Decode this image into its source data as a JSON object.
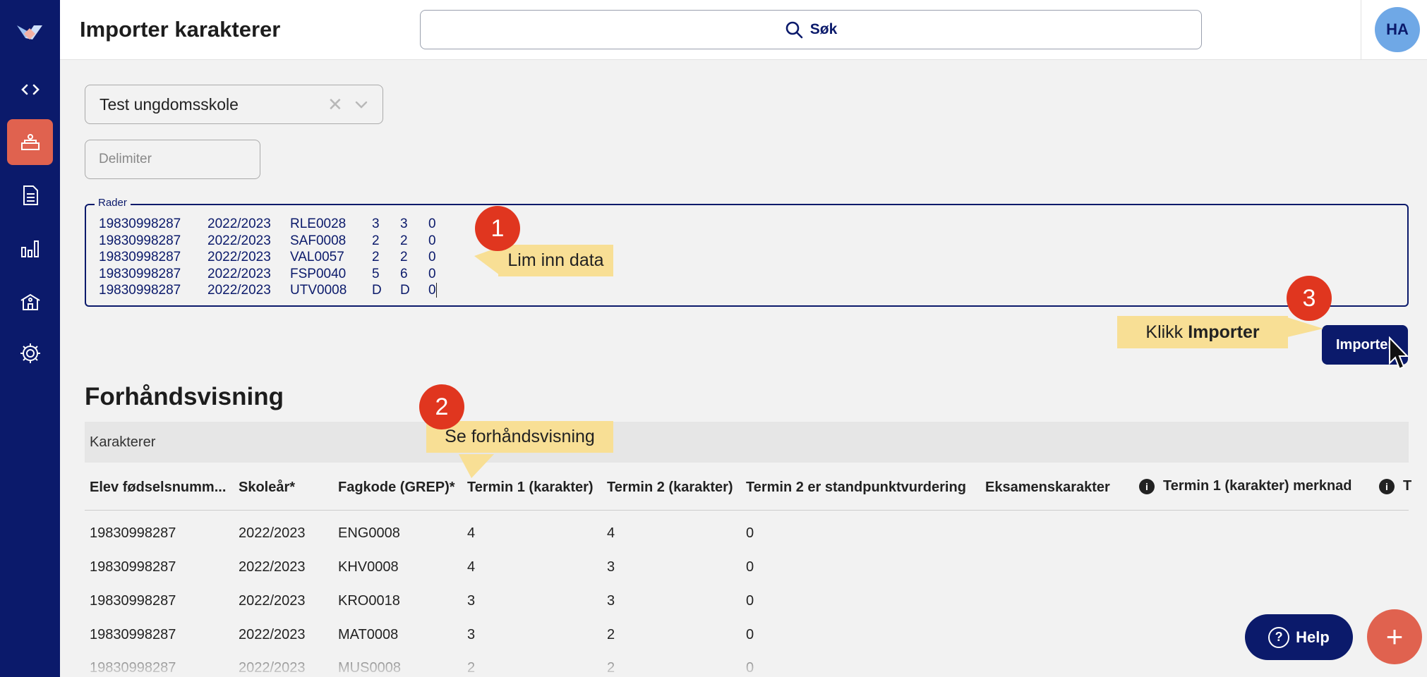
{
  "header": {
    "title": "Importer karakterer",
    "search_label": "Søk",
    "avatar_initials": "HA"
  },
  "sidebar": {
    "items": [
      {
        "icon": "code-icon"
      },
      {
        "icon": "school-desk-icon",
        "active": true
      },
      {
        "icon": "document-icon"
      },
      {
        "icon": "bar-chart-icon"
      },
      {
        "icon": "school-building-icon"
      },
      {
        "icon": "gear-icon"
      }
    ]
  },
  "form": {
    "school_select_value": "Test ungdomsskole",
    "clear_glyph": "✕",
    "delimiter_placeholder": "Delimiter",
    "rader_label": "Rader",
    "rader_rows": [
      [
        "19830998287",
        "2022/2023",
        "RLE0028",
        "3",
        "3",
        "0"
      ],
      [
        "19830998287",
        "2022/2023",
        "SAF0008",
        "2",
        "2",
        "0"
      ],
      [
        "19830998287",
        "2022/2023",
        "VAL0057",
        "2",
        "2",
        "0"
      ],
      [
        "19830998287",
        "2022/2023",
        "FSP0040",
        "5",
        "6",
        "0"
      ],
      [
        "19830998287",
        "2022/2023",
        "UTV0008",
        "D",
        "D",
        "0"
      ]
    ],
    "import_button": "Importer"
  },
  "preview": {
    "title": "Forhåndsvisning",
    "section_label": "Karakterer",
    "columns": [
      "Elev fødselsnumm...",
      "Skoleår*",
      "Fagkode (GREP)*",
      "Termin 1 (karakter)",
      "Termin 2 (karakter)",
      "Termin 2 er standpunktvurdering",
      "Eksamenskarakter",
      "Termin 1 (karakter) merknad",
      "T"
    ],
    "info_glyph": "i",
    "rows": [
      [
        "19830998287",
        "2022/2023",
        "ENG0008",
        "4",
        "4",
        "0"
      ],
      [
        "19830998287",
        "2022/2023",
        "KHV0008",
        "4",
        "3",
        "0"
      ],
      [
        "19830998287",
        "2022/2023",
        "KRO0018",
        "3",
        "3",
        "0"
      ],
      [
        "19830998287",
        "2022/2023",
        "MAT0008",
        "3",
        "2",
        "0"
      ],
      [
        "19830998287",
        "2022/2023",
        "MUS0008",
        "2",
        "2",
        "0"
      ]
    ]
  },
  "callouts": {
    "step1": {
      "number": "1",
      "text": "Lim inn data"
    },
    "step2": {
      "number": "2",
      "text": "Se forhåndsvisning"
    },
    "step3": {
      "number": "3",
      "text_prefix": "Klikk",
      "text_bold": "Importer"
    }
  },
  "help": {
    "label": "Help",
    "q_glyph": "?"
  },
  "fab_glyph": "+",
  "colors": {
    "navy": "#0b1a6b",
    "accent": "#e0624f",
    "badge_red": "#e0361f",
    "note_yellow": "#f8df95"
  }
}
